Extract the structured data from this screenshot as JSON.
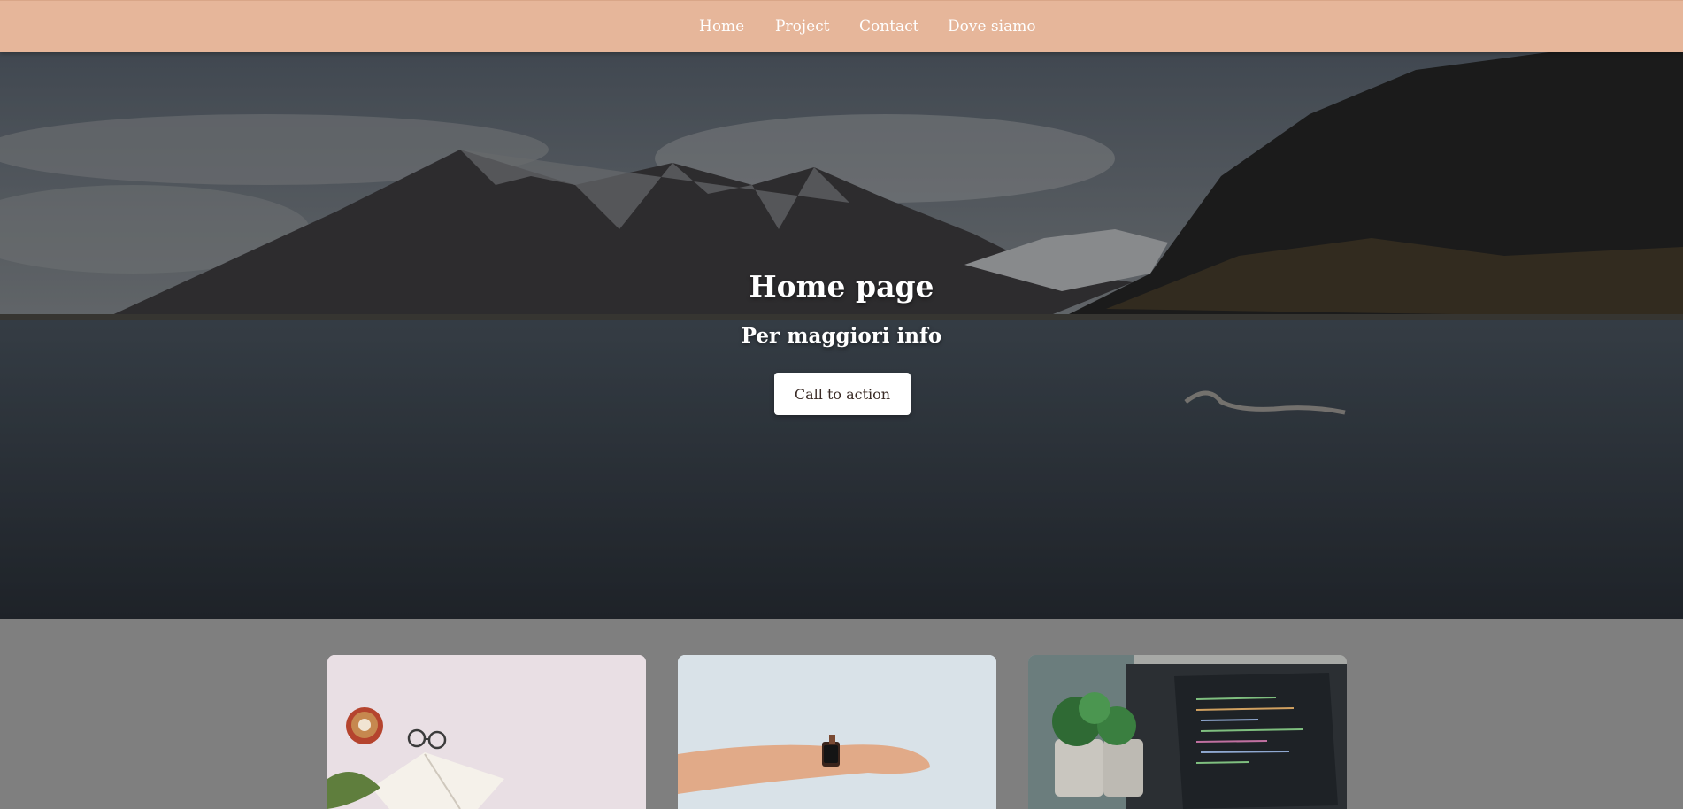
{
  "nav": {
    "items": [
      {
        "label": "Home"
      },
      {
        "label": "Project"
      },
      {
        "label": "Contact"
      },
      {
        "label": "Dove siamo"
      }
    ]
  },
  "hero": {
    "title": "Home page",
    "subtitle": "Per maggiori info",
    "cta_label": "Call to action"
  },
  "colors": {
    "navbar": "#e6b69a",
    "page_background": "#7f7f7f",
    "cta_background": "#ffffff"
  },
  "cards": [
    {
      "image": "coffee-book-glasses-photo"
    },
    {
      "image": "wrist-smartwatch-photo"
    },
    {
      "image": "plants-laptop-code-photo"
    }
  ]
}
